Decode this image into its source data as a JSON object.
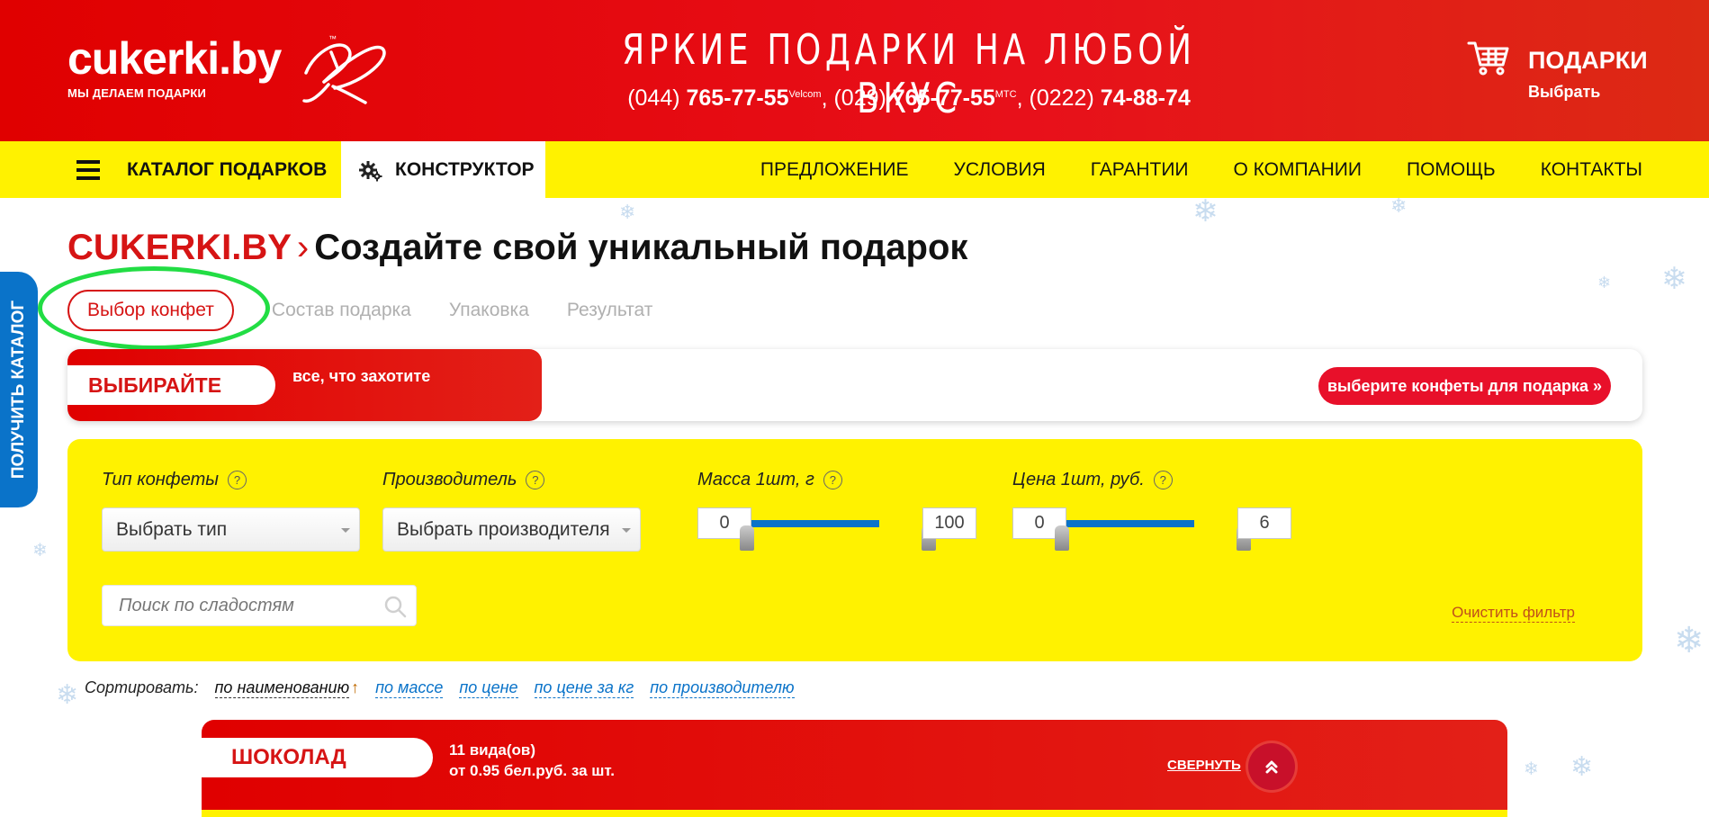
{
  "header": {
    "logo_text": "cukerki.by",
    "logo_tm": "™",
    "logo_tagline": "МЫ ДЕЛАЕМ ПОДАРКИ",
    "slogan": "ЯРКИЕ ПОДАРКИ НА ЛЮБОЙ ВКУС",
    "phones": [
      {
        "code": "(044) ",
        "number": "765-77-55",
        "operator": "Velcom",
        "sep": ",  "
      },
      {
        "code": "(029) ",
        "number": "765-77-55",
        "operator": "МТС",
        "sep": ",  "
      },
      {
        "code": "(0222) ",
        "number": "74-88-74",
        "operator": "",
        "sep": ""
      }
    ],
    "cart_title": "ПОДАРКИ",
    "cart_subtitle": "Выбрать",
    "cart_icon": "shopping-cart-icon"
  },
  "nav": {
    "catalog_label": "КАТАЛОГ ПОДАРКОВ",
    "constructor_label": "КОНСТРУКТОР",
    "links": [
      "ПРЕДЛОЖЕНИЕ",
      "УСЛОВИЯ",
      "ГАРАНТИИ",
      "О КОМПАНИИ",
      "ПОМОЩЬ",
      "КОНТАКТЫ"
    ]
  },
  "side_tab": {
    "label": "ПОЛУЧИТЬ КАТАЛОГ"
  },
  "breadcrumb": {
    "brand": "CUKERKI.BY",
    "separator": "›",
    "title": "Создайте свой уникальный подарок"
  },
  "steps": [
    "Выбор конфет",
    "Состав подарка",
    "Упаковка",
    "Результат"
  ],
  "banner": {
    "pill": "ВЫБИРАЙТЕ",
    "text": "все, что захотите",
    "button": "выберите конфеты для подарка »"
  },
  "filter": {
    "type_label": "Тип конфеты",
    "type_value": "Выбрать тип",
    "maker_label": "Производитель",
    "maker_value": "Выбрать производителя",
    "mass_label": "Масса 1шт, г",
    "mass_min": "0",
    "mass_max": "100",
    "price_label": "Цена 1шт, руб.",
    "price_min": "0",
    "price_max": "6",
    "help_symbol": "?",
    "search_placeholder": "Поиск по сладостям",
    "clear_label": "Очистить фильтр"
  },
  "sort": {
    "label": "Сортировать:",
    "active": "по наименованию",
    "arrow": "↑",
    "options": [
      "по массе",
      "по цене",
      "по цене за кг",
      "по производителю"
    ]
  },
  "category": {
    "name": "ШОКОЛАД",
    "count": "11 вида(ов)",
    "price": "от 0.95 бел.руб. за шт.",
    "collapse": "СВЕРНУТЬ"
  },
  "colors": {
    "brand_red": "#e00000",
    "nav_yellow": "#fff200",
    "accent_blue": "#0a73c9",
    "highlight_green": "#22dd44"
  }
}
